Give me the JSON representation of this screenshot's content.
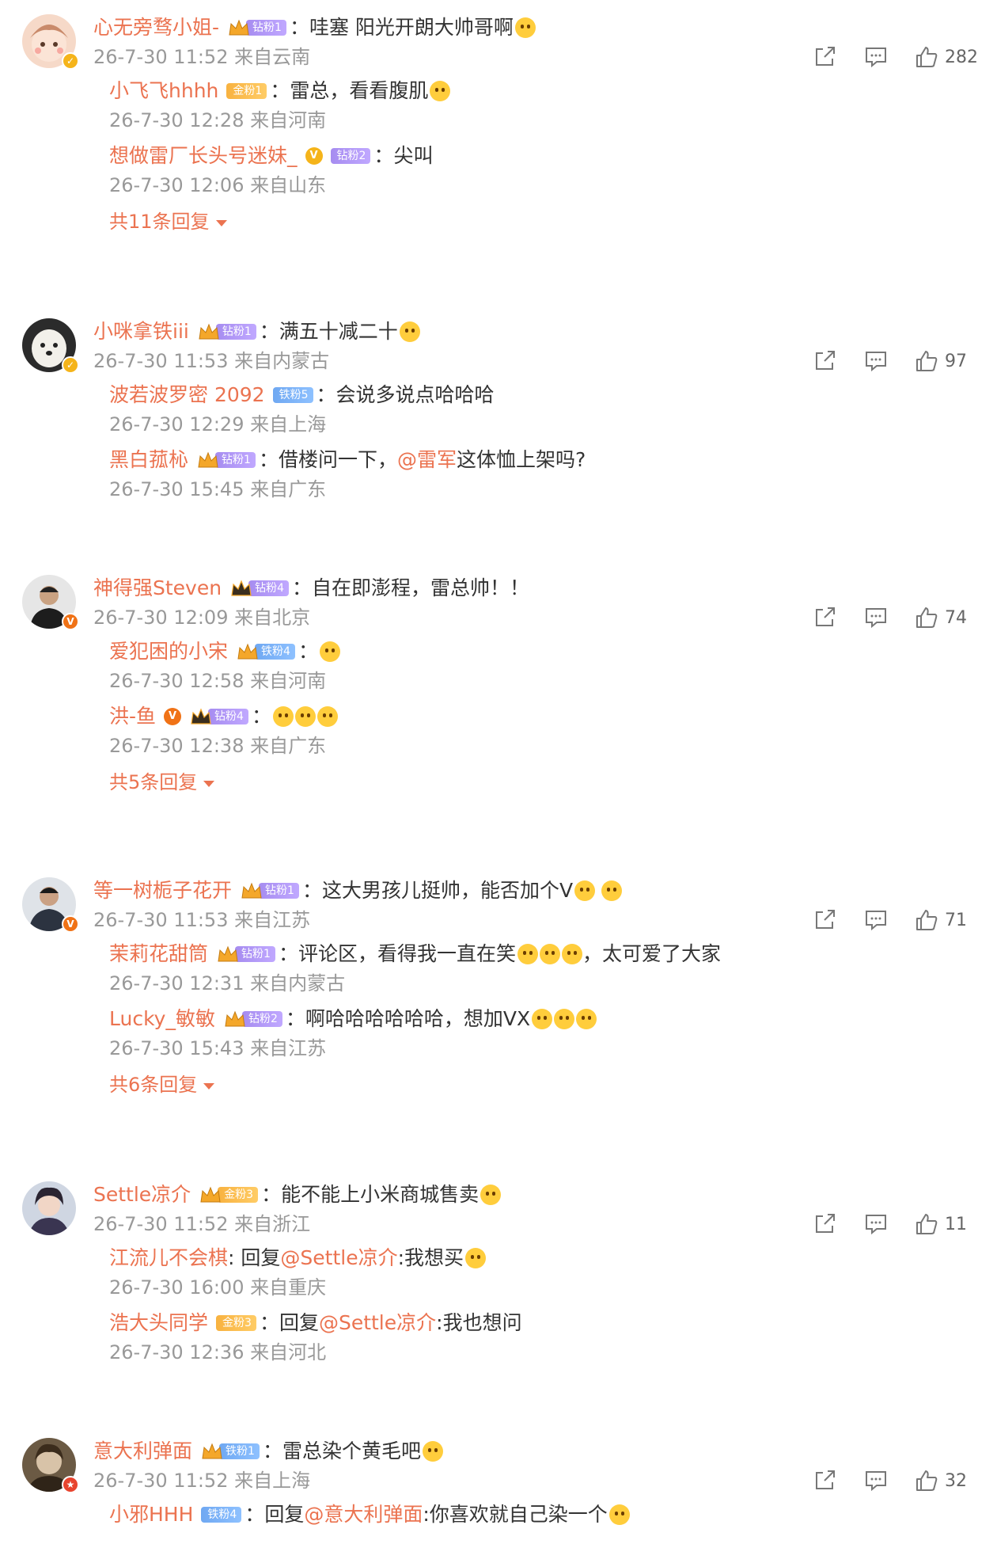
{
  "comments": [
    {
      "user": "心无旁骛小姐-",
      "fan_label": "钻粉1",
      "text": "：哇塞 阳光开朗大帅哥啊",
      "meta": "26-7-30 11:52 来自云南",
      "likes": "282",
      "replies": [
        {
          "user": "小飞飞hhhh",
          "fan_label": "金粉1",
          "text": "：雷总，看看腹肌",
          "meta": "26-7-30 12:28 来自河南"
        },
        {
          "user": "想做雷厂长头号迷妹_",
          "fan_label": "钻粉2",
          "text": "：尖叫",
          "meta": "26-7-30 12:06 来自山东"
        }
      ],
      "more": "共11条回复"
    },
    {
      "user": "小咪拿铁iii",
      "fan_label": "钻粉1",
      "text": "：满五十减二十",
      "meta": "26-7-30 11:53 来自内蒙古",
      "likes": "97",
      "replies": [
        {
          "user": "波若波罗密 2092",
          "fan_label": "铁粉5",
          "text": "：会说多说点哈哈哈",
          "meta": "26-7-30 12:29 来自上海"
        },
        {
          "user": "黑白菰杺",
          "fan_label": "钻粉1",
          "text_before": "：借楼问一下，",
          "at": "@雷军",
          "text_after": " 这体恤上架吗?",
          "meta": "26-7-30 15:45 来自广东"
        }
      ]
    },
    {
      "user": "神得强Steven",
      "fan_label": "钻粉4",
      "text": "：自在即澎程，雷总帅！！",
      "meta": "26-7-30 12:09 来自北京",
      "likes": "74",
      "replies": [
        {
          "user": "爱犯困的小宋",
          "fan_label": "铁粉4",
          "text": "：",
          "meta": "26-7-30 12:58 来自河南"
        },
        {
          "user": "洪-鱼",
          "fan_label": "钻粉4",
          "text": "：",
          "meta": "26-7-30 12:38 来自广东"
        }
      ],
      "more": "共5条回复"
    },
    {
      "user": "等一树栀子花开",
      "fan_label": "钻粉1",
      "text": "：这大男孩儿挺帅，能否加个V",
      "meta": "26-7-30 11:53 来自江苏",
      "likes": "71",
      "replies": [
        {
          "user": "茉莉花甜筒",
          "fan_label": "钻粉1",
          "text": "：评论区，看得我一直在笑",
          "text_after": "，太可爱了大家",
          "meta": "26-7-30 12:31 来自内蒙古"
        },
        {
          "user": "Lucky_敏敏",
          "fan_label": "钻粉2",
          "text": "：啊哈哈哈哈哈哈，想加VX",
          "meta": "26-7-30 15:43 来自江苏"
        }
      ],
      "more": "共6条回复"
    },
    {
      "user": "Settle凉介",
      "fan_label": "金粉3",
      "text": "：能不能上小米商城售卖",
      "meta": "26-7-30 11:52 来自浙江",
      "likes": "11",
      "replies": [
        {
          "user": "江流儿不会棋",
          "text_before": ": 回复 ",
          "at": "@Settle凉介",
          "text_after": ":我想买",
          "meta": "26-7-30 16:00 来自重庆"
        },
        {
          "user": "浩大头同学",
          "fan_label": "金粉3",
          "text_before": "：回复 ",
          "at": "@Settle凉介",
          "text_after": ":我也想问",
          "meta": "26-7-30 12:36 来自河北"
        }
      ]
    },
    {
      "user": "意大利弹面",
      "fan_label": "铁粉1",
      "text": "：雷总染个黄毛吧",
      "meta": "26-7-30 11:52 来自上海",
      "likes": "32",
      "replies": [
        {
          "user": "小邪HHH",
          "fan_label": "铁粉4",
          "text_before": "：回复 ",
          "at": "@意大利弹面",
          "text_after": ":你喜欢就自己染一个"
        }
      ]
    }
  ],
  "icons": {
    "share": "share-icon",
    "comment": "comment-icon",
    "like": "thumbs-up-icon"
  },
  "colors": {
    "name": "#eb7350",
    "meta": "#999999",
    "text": "#333333"
  }
}
